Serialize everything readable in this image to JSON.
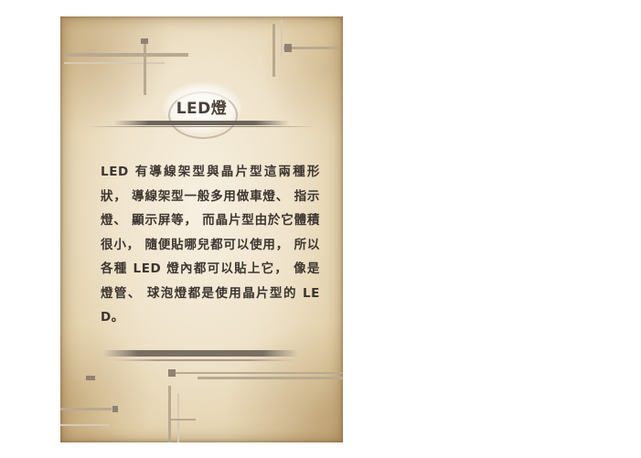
{
  "card": {
    "title": "LED燈",
    "body": "LED 有導線架型與晶片型這兩種形狀， 導線架型一般多用做車燈、 指示燈、 顯示屏等， 而晶片型由於它體積很小， 隨便貼哪兒都可以使用， 所以各種 LED 燈內都可以貼上它， 像是燈管、 球泡燈都是使用晶片型的 LED。"
  },
  "colors": {
    "parchment": "#efe3cb",
    "text": "#3c3530",
    "title": "#4a4036",
    "ornament": "#8f8273"
  }
}
